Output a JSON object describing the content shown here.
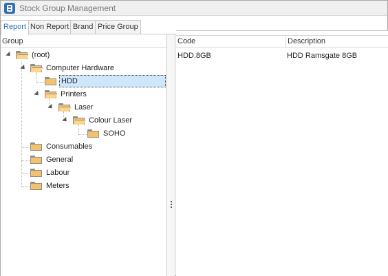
{
  "window": {
    "title": "Stock Group Management"
  },
  "tabs": [
    {
      "label": "Report",
      "active": true
    },
    {
      "label": "Non Report",
      "active": false
    },
    {
      "label": "Brand",
      "active": false
    },
    {
      "label": "Price Group",
      "active": false
    }
  ],
  "tree": {
    "header": "Group",
    "nodes": [
      {
        "label": "(root)",
        "expanded": true
      },
      {
        "label": "Computer Hardware",
        "expanded": true
      },
      {
        "label": "HDD",
        "selected": true
      },
      {
        "label": "Printers",
        "expanded": true
      },
      {
        "label": "Laser",
        "expanded": true
      },
      {
        "label": "Colour Laser",
        "expanded": true
      },
      {
        "label": "SOHO"
      },
      {
        "label": "Consumables"
      },
      {
        "label": "General"
      },
      {
        "label": "Labour"
      },
      {
        "label": "Meters"
      }
    ]
  },
  "grid": {
    "columns": [
      "Code",
      "Description"
    ],
    "rows": [
      {
        "code": "HDD.8GB",
        "description": "HDD Ramsgate 8GB"
      }
    ]
  },
  "colors": {
    "accent": "#2a6fbf",
    "folder": "#f5c26b",
    "selection": "#cfe6fb"
  }
}
